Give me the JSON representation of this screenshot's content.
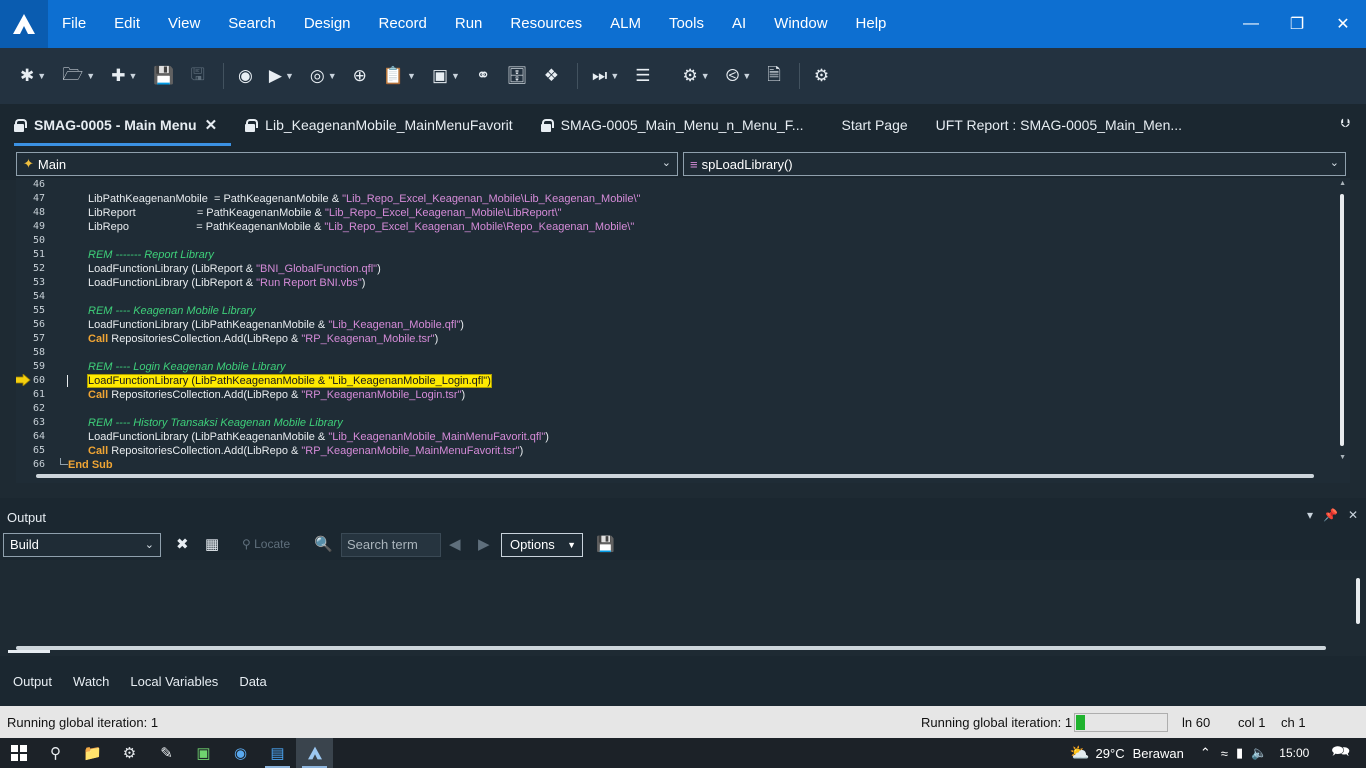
{
  "app": {
    "menu": [
      "File",
      "Edit",
      "View",
      "Search",
      "Design",
      "Record",
      "Run",
      "Resources",
      "ALM",
      "Tools",
      "AI",
      "Window",
      "Help"
    ]
  },
  "tabs": [
    {
      "label": "SMAG-0005 - Main Menu",
      "locked": true,
      "active": true
    },
    {
      "label": "Lib_KeagenanMobile_MainMenuFavorit",
      "locked": true,
      "active": false
    },
    {
      "label": "SMAG-0005_Main_Menu_n_Menu_F...",
      "locked": true,
      "active": false
    },
    {
      "label": "Start Page",
      "locked": false,
      "active": false
    },
    {
      "label": "UFT Report : SMAG-0005_Main_Men...",
      "locked": false,
      "active": false
    }
  ],
  "editor": {
    "scope_dropdown": "Main",
    "function_dropdown": "spLoadLibrary()",
    "current_line": 60,
    "lines": [
      {
        "n": "46",
        "t": []
      },
      {
        "n": "47",
        "t": [
          [
            "p",
            "LibPathKeagenanMobile  = PathKeagenanMobile & "
          ],
          [
            "s",
            "\"Lib_Repo_Excel_Keagenan_Mobile\\Lib_Keagenan_Mobile\\\""
          ]
        ]
      },
      {
        "n": "48",
        "t": [
          [
            "p",
            "LibReport                    = PathKeagenanMobile & "
          ],
          [
            "s",
            "\"Lib_Repo_Excel_Keagenan_Mobile\\LibReport\\\""
          ]
        ]
      },
      {
        "n": "49",
        "t": [
          [
            "p",
            "LibRepo                      = PathKeagenanMobile & "
          ],
          [
            "s",
            "\"Lib_Repo_Excel_Keagenan_Mobile\\Repo_Keagenan_Mobile\\\""
          ]
        ]
      },
      {
        "n": "50",
        "t": []
      },
      {
        "n": "51",
        "t": [
          [
            "r",
            "REM ------- Report Library"
          ]
        ]
      },
      {
        "n": "52",
        "t": [
          [
            "p",
            "LoadFunctionLibrary (LibReport & "
          ],
          [
            "s",
            "\"BNI_GlobalFunction.qfl\""
          ],
          [
            "p",
            ")"
          ]
        ]
      },
      {
        "n": "53",
        "t": [
          [
            "p",
            "LoadFunctionLibrary (LibReport & "
          ],
          [
            "s",
            "\"Run Report BNI.vbs\""
          ],
          [
            "p",
            ")"
          ]
        ]
      },
      {
        "n": "54",
        "t": []
      },
      {
        "n": "55",
        "t": [
          [
            "r",
            "REM ---- Keagenan Mobile Library"
          ]
        ]
      },
      {
        "n": "56",
        "t": [
          [
            "p",
            "LoadFunctionLibrary (LibPathKeagenanMobile & "
          ],
          [
            "s",
            "\"Lib_Keagenan_Mobile.qfl\""
          ],
          [
            "p",
            ")"
          ]
        ]
      },
      {
        "n": "57",
        "t": [
          [
            "k",
            "Call"
          ],
          [
            "p",
            " RepositoriesCollection.Add(LibRepo & "
          ],
          [
            "s",
            "\"RP_Keagenan_Mobile.tsr\""
          ],
          [
            "p",
            ")"
          ]
        ]
      },
      {
        "n": "58",
        "t": []
      },
      {
        "n": "59",
        "t": [
          [
            "r",
            "REM ---- Login Keagenan Mobile Library"
          ]
        ]
      },
      {
        "n": "60",
        "t": [
          [
            "h",
            "LoadFunctionLibrary (LibPathKeagenanMobile & \"Lib_KeagenanMobile_Login.qfl\")"
          ]
        ]
      },
      {
        "n": "61",
        "t": [
          [
            "k",
            "Call"
          ],
          [
            "p",
            " RepositoriesCollection.Add(LibRepo & "
          ],
          [
            "s",
            "\"RP_KeagenanMobile_Login.tsr\""
          ],
          [
            "p",
            ")"
          ]
        ]
      },
      {
        "n": "62",
        "t": []
      },
      {
        "n": "63",
        "t": [
          [
            "r",
            "REM ---- History Transaksi Keagenan Mobile Library"
          ]
        ]
      },
      {
        "n": "64",
        "t": [
          [
            "p",
            "LoadFunctionLibrary (LibPathKeagenanMobile & "
          ],
          [
            "s",
            "\"Lib_KeagenanMobile_MainMenuFavorit.qfl\""
          ],
          [
            "p",
            ")"
          ]
        ]
      },
      {
        "n": "65",
        "t": [
          [
            "k",
            "Call"
          ],
          [
            "p",
            " RepositoriesCollection.Add(LibRepo & "
          ],
          [
            "s",
            "\"RP_KeagenanMobile_MainMenuFavorit.tsr\""
          ],
          [
            "p",
            ")"
          ]
        ]
      },
      {
        "n": "66",
        "t": [
          [
            "e",
            "End Sub"
          ]
        ]
      }
    ]
  },
  "output": {
    "title": "Output",
    "build_select": "Build",
    "locate_label": "Locate",
    "search_placeholder": "Search term",
    "options_label": "Options"
  },
  "bottom_tabs": [
    "Output",
    "Watch",
    "Local Variables",
    "Data"
  ],
  "status": {
    "left_text": "Running global iteration: 1",
    "right_text": "Running global iteration: 1",
    "progress": 0.1,
    "ln": "ln 60",
    "col": "col 1",
    "ch": "ch 1"
  },
  "taskbar": {
    "weather_temp": "29°C",
    "weather_desc": "Berawan",
    "time": "15:00"
  },
  "colors": {
    "accent": "#0d6fd1",
    "string": "#d58bd8",
    "keyword": "#f0a534",
    "comment": "#3ed07a",
    "highlight": "#ffea00"
  }
}
